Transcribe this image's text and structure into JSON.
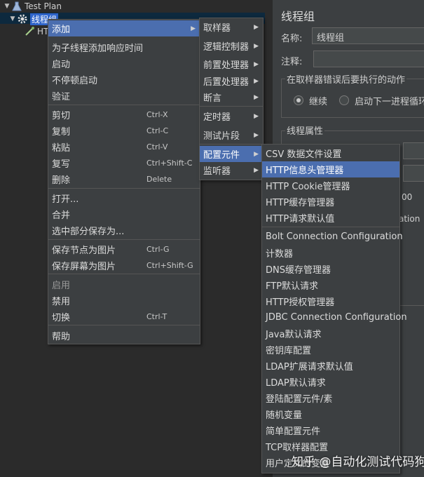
{
  "tree": {
    "test_plan": "Test Plan",
    "thread_group": "线程组",
    "http_fragment": "HT"
  },
  "panel": {
    "title": "线程组",
    "name_label": "名称:",
    "name_value": "线程组",
    "comment_label": "注释:",
    "error_group_title": "在取样器错误后要执行的动作",
    "radio_continue": "继续",
    "radio_next_loop": "启动下一进程循环",
    "props_title": "线程属性",
    "fragment_1": "00",
    "fragment_2": "ation"
  },
  "context_menu": {
    "items": [
      {
        "label": "添加",
        "highlight": true,
        "submenu": true
      },
      {
        "label": "为子线程添加响应时间"
      },
      {
        "label": "启动"
      },
      {
        "label": "不停顿启动"
      },
      {
        "label": "验证"
      },
      {
        "label": "剪切",
        "shortcut": "Ctrl-X"
      },
      {
        "label": "复制",
        "shortcut": "Ctrl-C"
      },
      {
        "label": "粘贴",
        "shortcut": "Ctrl-V"
      },
      {
        "label": "复写",
        "shortcut": "Ctrl+Shift-C"
      },
      {
        "label": "删除",
        "shortcut": "Delete"
      },
      {
        "label": "打开..."
      },
      {
        "label": "合并"
      },
      {
        "label": "选中部分保存为..."
      },
      {
        "label": "保存节点为图片",
        "shortcut": "Ctrl-G"
      },
      {
        "label": "保存屏幕为图片",
        "shortcut": "Ctrl+Shift-G"
      },
      {
        "label": "启用",
        "disabled": true
      },
      {
        "label": "禁用"
      },
      {
        "label": "切换",
        "shortcut": "Ctrl-T"
      },
      {
        "label": "帮助"
      }
    ]
  },
  "add_menu": {
    "items": [
      {
        "label": "取样器"
      },
      {
        "label": "逻辑控制器"
      },
      {
        "label": "前置处理器"
      },
      {
        "label": "后置处理器"
      },
      {
        "label": "断言"
      },
      {
        "label": "定时器"
      },
      {
        "label": "测试片段"
      },
      {
        "label": "配置元件",
        "highlight": true
      },
      {
        "label": "监听器"
      }
    ]
  },
  "config_menu": {
    "items": [
      {
        "label": "CSV 数据文件设置"
      },
      {
        "label": "HTTP信息头管理器",
        "highlight": true
      },
      {
        "label": "HTTP Cookie管理器"
      },
      {
        "label": "HTTP缓存管理器"
      },
      {
        "label": "HTTP请求默认值"
      },
      {
        "label": "Bolt Connection Configuration"
      },
      {
        "label": "计数器"
      },
      {
        "label": "DNS缓存管理器"
      },
      {
        "label": "FTP默认请求"
      },
      {
        "label": "HTTP授权管理器"
      },
      {
        "label": "JDBC Connection Configuration"
      },
      {
        "label": "Java默认请求"
      },
      {
        "label": "密钥库配置"
      },
      {
        "label": "LDAP扩展请求默认值"
      },
      {
        "label": "LDAP默认请求"
      },
      {
        "label": "登陆配置元件/素"
      },
      {
        "label": "随机变量"
      },
      {
        "label": "简单配置元件"
      },
      {
        "label": "TCP取样器配置"
      },
      {
        "label": "用户定义的变量"
      }
    ]
  },
  "watermark": "知乎 @自动化测试代码狗",
  "colors": {
    "background": "#2b2b2b",
    "panel": "#3c3f41",
    "menu_highlight": "#4b6eaf",
    "tree_selected": "#2f65ca"
  }
}
